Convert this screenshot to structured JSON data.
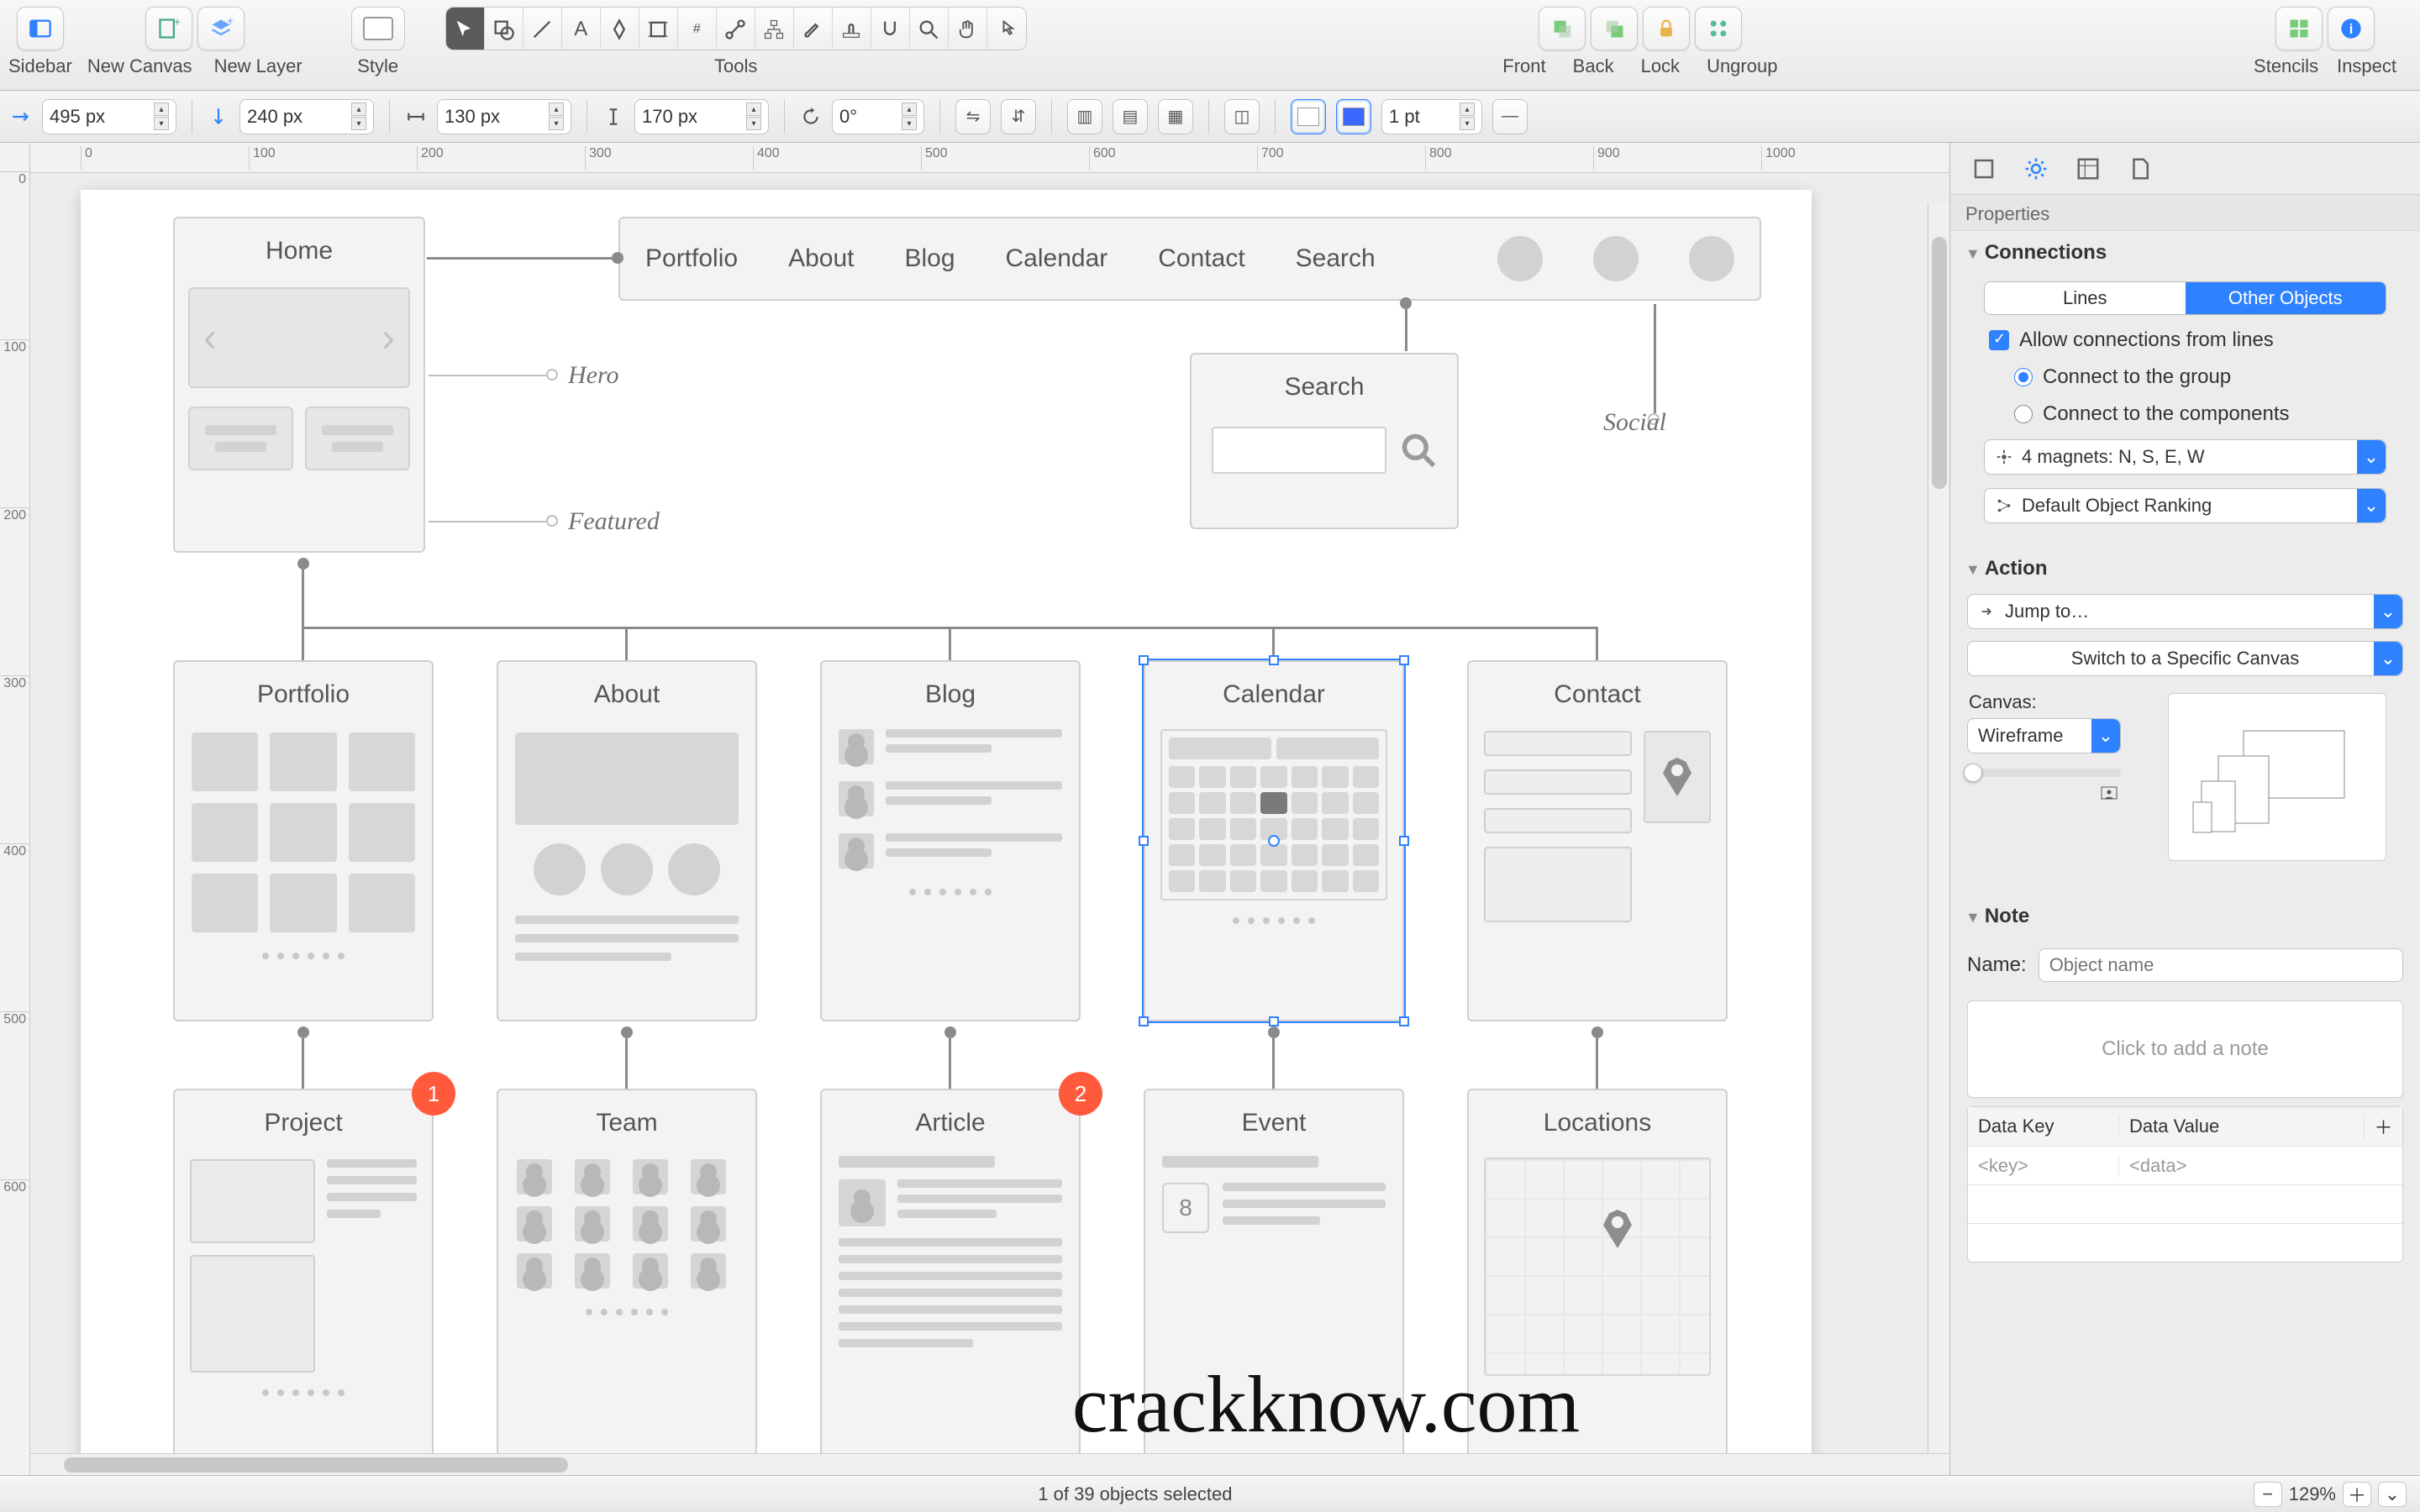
{
  "toolbar": {
    "sidebar": "Sidebar",
    "newCanvas": "New Canvas",
    "newLayer": "New Layer",
    "style": "Style",
    "tools": "Tools",
    "front": "Front",
    "back": "Back",
    "lock": "Lock",
    "ungroup": "Ungroup",
    "stencils": "Stencils",
    "inspect": "Inspect"
  },
  "dims": {
    "x": "495 px",
    "y": "240 px",
    "w": "130 px",
    "h": "170 px",
    "rot": "0°",
    "stroke": "1 pt"
  },
  "rulerH": [
    "0",
    "100",
    "200",
    "300",
    "400",
    "500",
    "600",
    "700",
    "800",
    "900",
    "1000"
  ],
  "rulerV": [
    "0",
    "100",
    "200",
    "300",
    "400",
    "500",
    "600"
  ],
  "nav": [
    "Portfolio",
    "About",
    "Blog",
    "Calendar",
    "Contact",
    "Search"
  ],
  "annot": {
    "hero": "Hero",
    "featured": "Featured",
    "social": "Social"
  },
  "cards": {
    "home": "Home",
    "search": "Search",
    "row2": [
      "Portfolio",
      "About",
      "Blog",
      "Calendar",
      "Contact"
    ],
    "row3": [
      "Project",
      "Team",
      "Article",
      "Event",
      "Locations"
    ]
  },
  "eventDay": "8",
  "badges": [
    "1",
    "2"
  ],
  "watermark": "crackknow.com",
  "inspector": {
    "propsLabel": "Properties",
    "connections": "Connections",
    "segLines": "Lines",
    "segOther": "Other Objects",
    "allow": "Allow connections from lines",
    "rGroup": "Connect to the group",
    "rComp": "Connect to the components",
    "magnets": "4 magnets: N, S, E, W",
    "ranking": "Default Object Ranking",
    "action": "Action",
    "jump": "Jump to…",
    "switch": "Switch to a Specific Canvas",
    "canvasLabel": "Canvas:",
    "canvasVal": "Wireframe",
    "note": "Note",
    "nameLabel": "Name:",
    "namePh": "Object name",
    "notePh": "Click to add a note",
    "kHead": "Data Key",
    "vHead": "Data Value",
    "kPh": "<key>",
    "vPh": "<data>"
  },
  "status": {
    "sel": "1 of 39 objects selected",
    "zoom": "129%"
  }
}
